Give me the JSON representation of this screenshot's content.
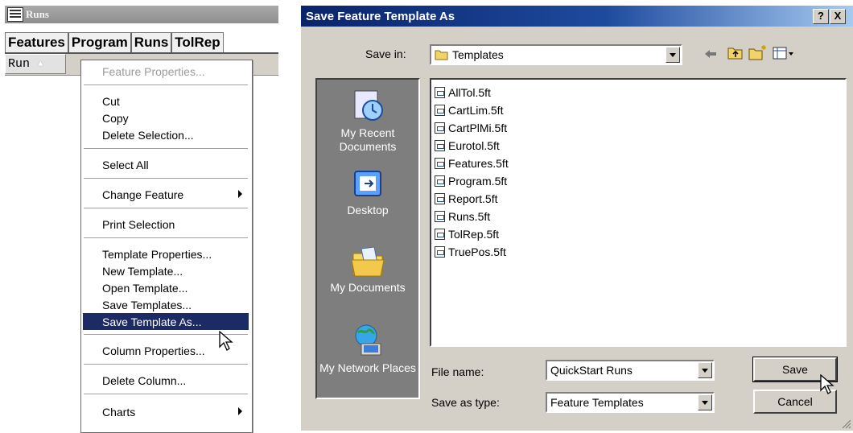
{
  "runs_window": {
    "title": "Runs",
    "tabs": [
      "Features",
      "Program",
      "Runs",
      "TolRep"
    ],
    "column_header": "Run"
  },
  "context_menu": {
    "items": [
      {
        "label": "Feature Properties...",
        "disabled": true
      },
      {
        "label": "Cut"
      },
      {
        "label": "Copy"
      },
      {
        "label": "Delete Selection..."
      },
      {
        "label": "Select All"
      },
      {
        "label": "Change Feature",
        "submenu": true
      },
      {
        "label": "Print Selection"
      },
      {
        "label": "Template Properties..."
      },
      {
        "label": "New Template..."
      },
      {
        "label": "Open Template..."
      },
      {
        "label": "Save Templates..."
      },
      {
        "label": "Save Template As...",
        "selected": true
      },
      {
        "label": "Column Properties..."
      },
      {
        "label": "Delete Column..."
      },
      {
        "label": "Charts",
        "submenu": true
      }
    ]
  },
  "dialog": {
    "title": "Save Feature Template As",
    "help_button": "?",
    "close_button": "X",
    "save_in_label": "Save in:",
    "save_in_value": "Templates",
    "places": [
      "My Recent Documents",
      "Desktop",
      "My Documents",
      "My Network Places"
    ],
    "files": [
      "AllTol.5ft",
      "CartLim.5ft",
      "CartPlMi.5ft",
      "Eurotol.5ft",
      "Features.5ft",
      "Program.5ft",
      "Report.5ft",
      "Runs.5ft",
      "TolRep.5ft",
      "TruePos.5ft"
    ],
    "file_name_label": "File name:",
    "file_name_value": "QuickStart Runs",
    "save_as_type_label": "Save as type:",
    "save_as_type_value": "Feature Templates",
    "save_button": "Save",
    "cancel_button": "Cancel"
  }
}
